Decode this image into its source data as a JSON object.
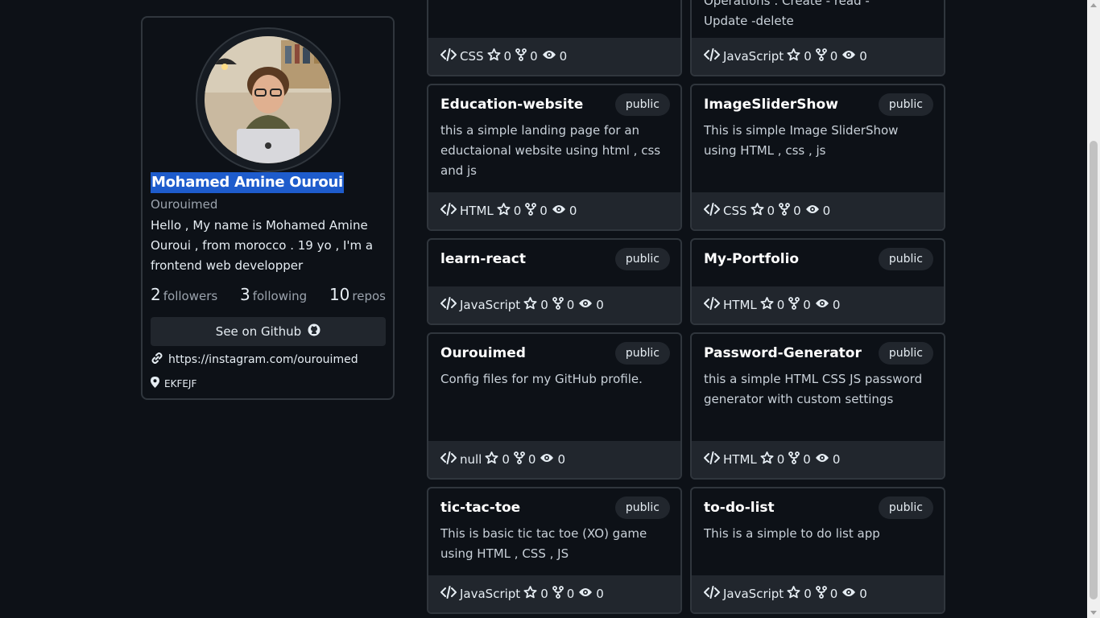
{
  "profile": {
    "name": "Mohamed Amine Ouroui",
    "login": "Ourouimed",
    "bio": "Hello , My name is Mohamed Amine Ouroui , from morocco . 19 yo , I'm a frontend web developper",
    "followers_count": "2",
    "followers_label": "followers",
    "following_count": "3",
    "following_label": "following",
    "repos_count": "10",
    "repos_label": "repos",
    "github_button": "See on Github",
    "link": "https://instagram.com/ourouimed",
    "location": "EKFEJF"
  },
  "top_partial": {
    "left": {
      "lang": "CSS",
      "stars": "0",
      "forks": "0",
      "watchers": "0"
    },
    "right": {
      "desc": "Operations : Create - read - Update -delete",
      "lang": "JavaScript",
      "stars": "0",
      "forks": "0",
      "watchers": "0"
    }
  },
  "repos": [
    {
      "name": "Education-website",
      "visibility": "public",
      "desc": "this a simple landing page for an eductaional website using html , css and js",
      "lang": "HTML",
      "stars": "0",
      "forks": "0",
      "watchers": "0"
    },
    {
      "name": "ImageSliderShow",
      "visibility": "public",
      "desc": "This is simple Image SliderShow using HTML , css , js",
      "lang": "CSS",
      "stars": "0",
      "forks": "0",
      "watchers": "0"
    },
    {
      "name": "learn-react",
      "visibility": "public",
      "desc": "",
      "lang": "JavaScript",
      "stars": "0",
      "forks": "0",
      "watchers": "0"
    },
    {
      "name": "My-Portfolio",
      "visibility": "public",
      "desc": "",
      "lang": "HTML",
      "stars": "0",
      "forks": "0",
      "watchers": "0"
    },
    {
      "name": "Ourouimed",
      "visibility": "public",
      "desc": "Config files for my GitHub profile.",
      "lang": "null",
      "stars": "0",
      "forks": "0",
      "watchers": "0"
    },
    {
      "name": "Password-Generator",
      "visibility": "public",
      "desc": "this a simple HTML CSS JS password generator with custom settings",
      "lang": "HTML",
      "stars": "0",
      "forks": "0",
      "watchers": "0"
    },
    {
      "name": "tic-tac-toe",
      "visibility": "public",
      "desc": "This is basic tic tac toe (XO) game using HTML , CSS , JS",
      "lang": "JavaScript",
      "stars": "0",
      "forks": "0",
      "watchers": "0"
    },
    {
      "name": "to-do-list",
      "visibility": "public",
      "desc": "This is a simple to do list app",
      "lang": "JavaScript",
      "stars": "0",
      "forks": "0",
      "watchers": "0"
    }
  ],
  "colors": {
    "background": "#0d1117",
    "card_border": "#30363d",
    "footer_bg": "#21262d",
    "selection": "#1e5ccc"
  }
}
